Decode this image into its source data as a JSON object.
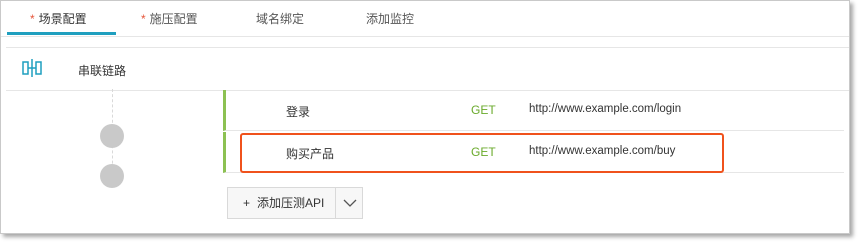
{
  "tabs": [
    {
      "label": "场景配置",
      "required": true,
      "active": true
    },
    {
      "label": "施压配置",
      "required": true,
      "active": false
    },
    {
      "label": "域名绑定",
      "required": false,
      "active": false
    },
    {
      "label": "添加监控",
      "required": false,
      "active": false
    }
  ],
  "required_mark": "*",
  "chain": {
    "icon": "chain-link-icon",
    "title": "串联链路"
  },
  "apis": [
    {
      "name": "登录",
      "method": "GET",
      "url": "http://www.example.com/login"
    },
    {
      "name": "购买产品",
      "method": "GET",
      "url": "http://www.example.com/buy"
    }
  ],
  "add_api": {
    "plus": "+",
    "label": "添加压测API",
    "dropdown_icon": "chevron-down-icon"
  },
  "colors": {
    "accent": "#1f9fbf",
    "required": "#e6553a",
    "method": "#6aaa2b",
    "row_bar": "#8cc152",
    "highlight": "#f0521c"
  }
}
